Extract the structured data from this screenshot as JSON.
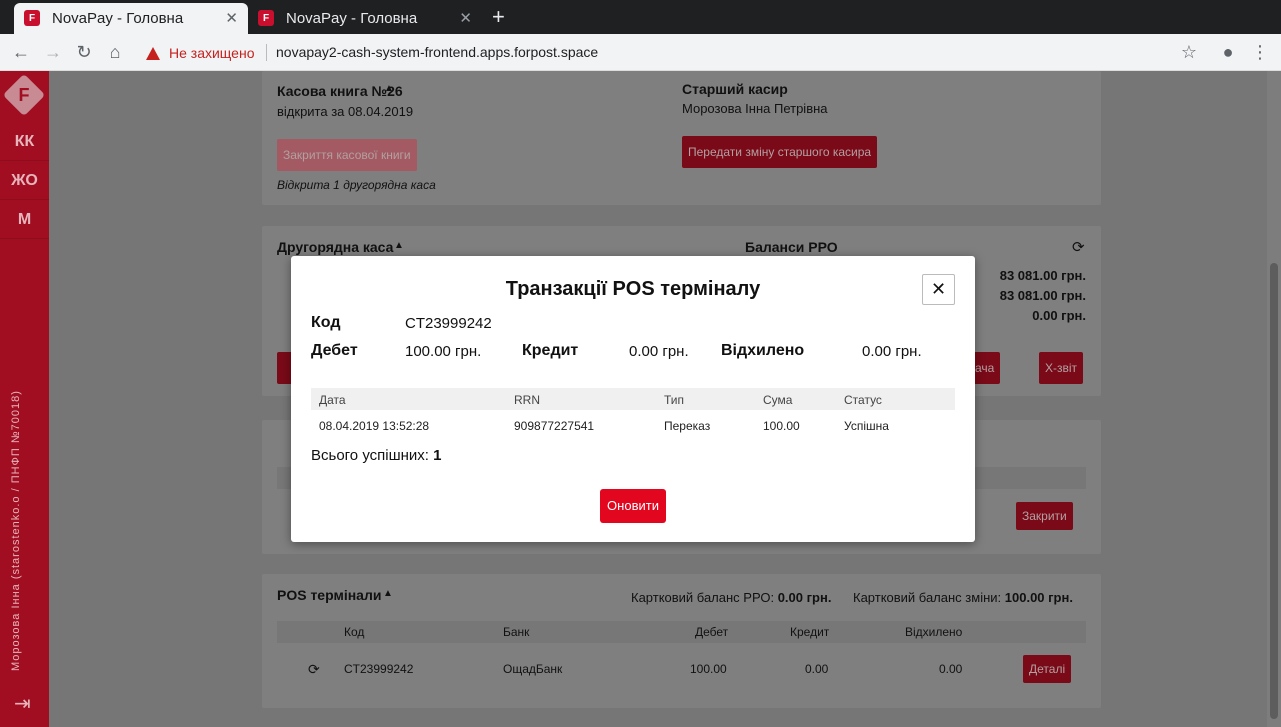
{
  "browser": {
    "tabs": [
      {
        "title": "NovaPay - Головна",
        "close": "✕"
      },
      {
        "title": "NovaPay - Головна",
        "close": "✕"
      }
    ],
    "new_tab": "+",
    "security_label": "Не захищено",
    "url": "novapay2-cash-system-frontend.apps.forpost.space"
  },
  "sidebar": {
    "logo": "F",
    "items": [
      {
        "label": "КК"
      },
      {
        "label": "ЖО"
      },
      {
        "label": "М"
      }
    ],
    "user_text": "Морозова Інна (starostenko.o / ПНФП №70018)"
  },
  "cashbook": {
    "title": "Касова книга №26",
    "opened": "відкрита за 08.04.2019",
    "close_btn": "Закриття касової книги",
    "note": "Відкрита 1 другорядна каса",
    "senior_label": "Старший касир",
    "senior_name": "Морозова Інна Петрівна",
    "transfer_btn": "Передати зміну старшого касира"
  },
  "secondary": {
    "title": "Другорядна каса",
    "balances_title": "Баланси РРО",
    "balances": [
      "83 081.00 грн.",
      "83 081.00 грн.",
      "0.00 грн."
    ],
    "side_btn": "дача",
    "xreport_btn": "Х-звіт",
    "close_btn": "Закрити"
  },
  "pos": {
    "title": "POS термінали",
    "card_balance_rro_label": "Картковий баланс РРО:",
    "card_balance_rro": "0.00 грн.",
    "card_balance_shift_label": "Картковий баланс зміни:",
    "card_balance_shift": "100.00 грн.",
    "headers": [
      "Код",
      "Банк",
      "Дебет",
      "Кредит",
      "Відхилено"
    ],
    "row": {
      "code": "CT23999242",
      "bank": "ОщадБанк",
      "debit": "100.00",
      "credit": "0.00",
      "rejected": "0.00"
    },
    "details_btn": "Деталі"
  },
  "modal": {
    "title": "Транзакції POS терміналу",
    "close": "✕",
    "code_label": "Код",
    "code_value": "CT23999242",
    "debit_label": "Дебет",
    "debit_value": "100.00 грн.",
    "credit_label": "Кредит",
    "credit_value": "0.00 грн.",
    "rejected_label": "Відхилено",
    "rejected_value": "0.00 грн.",
    "table": {
      "headers": [
        "Дата",
        "RRN",
        "Тип",
        "Сума",
        "Статус"
      ],
      "rows": [
        {
          "date": "08.04.2019 13:52:28",
          "rrn": "909877227541",
          "type": "Переказ",
          "sum": "100.00",
          "status": "Успішна"
        }
      ]
    },
    "total_label": "Всього успішних:",
    "total_value": "1",
    "refresh_btn": "Оновити"
  }
}
